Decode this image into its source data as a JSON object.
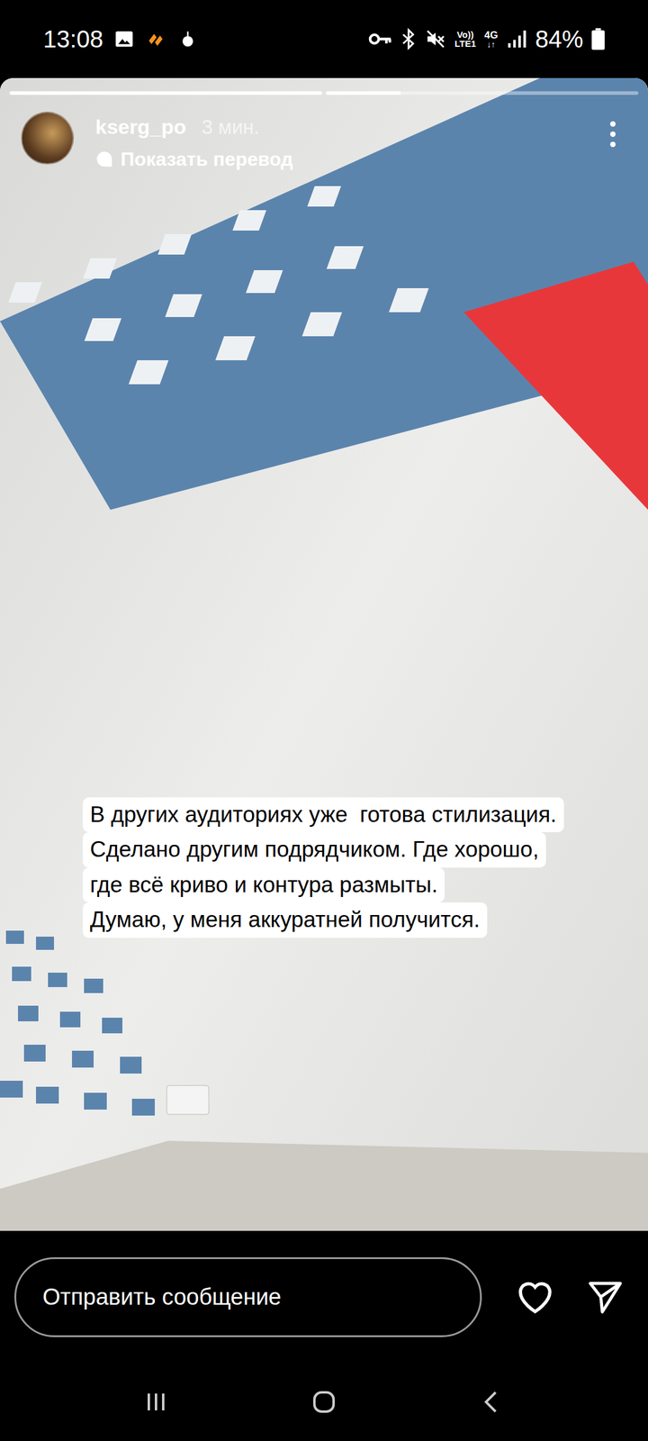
{
  "status_bar": {
    "time": "13:08",
    "volte": "Vo))",
    "lte": "LTE1",
    "network": "4G",
    "battery": "84%"
  },
  "story": {
    "progress": [
      {
        "level": 1
      },
      {
        "level": 0.24
      }
    ],
    "user": "kserg_po",
    "time": "3 мин.",
    "translate": "Показать перевод",
    "caption": [
      "В других аудиториях уже  готова стилизация.",
      "Сделано другим подрядчиком. Где хорошо,",
      "где всё криво и контура размыты.",
      "Думаю, у меня аккуратней получится."
    ]
  },
  "reply": {
    "placeholder": "Отправить сообщение"
  }
}
